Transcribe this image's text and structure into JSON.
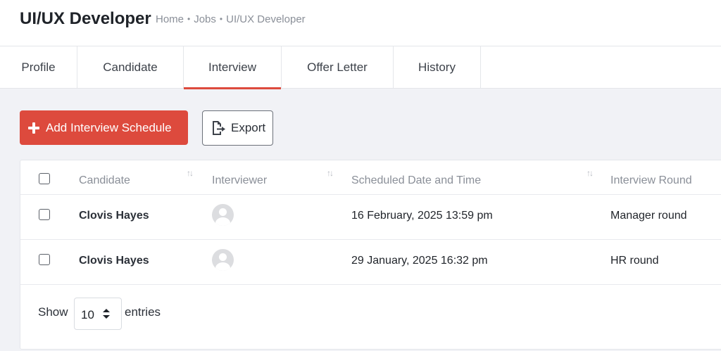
{
  "header": {
    "title": "UI/UX Developer",
    "breadcrumb": [
      "Home",
      "Jobs",
      "UI/UX Developer"
    ],
    "breadcrumb_separator": "•"
  },
  "tabs": [
    {
      "label": "Profile",
      "active": false
    },
    {
      "label": "Candidate",
      "active": false
    },
    {
      "label": "Interview",
      "active": true
    },
    {
      "label": "Offer Letter",
      "active": false
    },
    {
      "label": "History",
      "active": false
    }
  ],
  "toolbar": {
    "add_label": "Add Interview Schedule",
    "export_label": "Export"
  },
  "table": {
    "columns": [
      "Candidate",
      "Interviewer",
      "Scheduled Date and Time",
      "Interview Round"
    ],
    "rows": [
      {
        "candidate": "Clovis Hayes",
        "interviewer_avatar": "avatar-placeholder-icon",
        "scheduled": "16 February, 2025 13:59 pm",
        "round": "Manager round"
      },
      {
        "candidate": "Clovis Hayes",
        "interviewer_avatar": "avatar-placeholder-icon",
        "scheduled": "29 January, 2025 16:32 pm",
        "round": "HR round"
      }
    ]
  },
  "pagination": {
    "show_label": "Show",
    "page_size": "10",
    "entries_label": "entries"
  },
  "colors": {
    "accent": "#dd4a3d",
    "muted_text": "#8a8f98",
    "background": "#f1f2f6"
  }
}
